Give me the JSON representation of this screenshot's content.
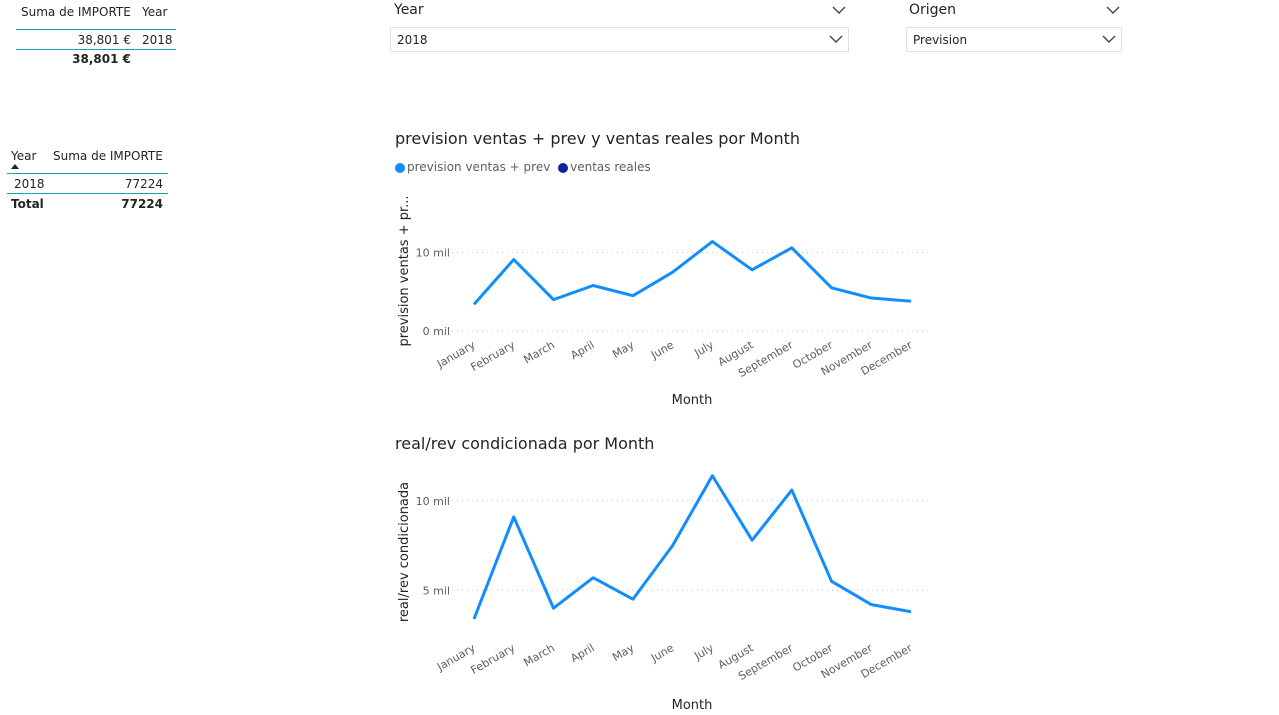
{
  "table_top": {
    "headers": [
      "Suma de IMPORTE",
      "Year"
    ],
    "row": {
      "importe": "38,801 €",
      "year": "2018"
    },
    "total": "38,801 €"
  },
  "table_left": {
    "headers": [
      "Year",
      "Suma de IMPORTE"
    ],
    "row": {
      "year": "2018",
      "importe": "77224"
    },
    "total_label": "Total",
    "total_value": "77224"
  },
  "slicer_year": {
    "title": "Year",
    "value": "2018"
  },
  "slicer_origen": {
    "title": "Origen",
    "value": "Prevision"
  },
  "chart1": {
    "title": "prevision ventas + prev y ventas reales por Month",
    "legend": [
      {
        "name": "prevision ventas + prev",
        "color": "#118DFF"
      },
      {
        "name": "ventas reales",
        "color": "#12239E"
      }
    ],
    "ylabel": "prevision ventas + pr...",
    "xlabel": "Month",
    "ytick_labels": [
      "0 mil",
      "10 mil"
    ]
  },
  "chart2": {
    "title": "real/rev condicionada por Month",
    "ylabel": "real/rev condicionada",
    "xlabel": "Month",
    "ytick_labels": [
      "5 mil",
      "10 mil"
    ]
  },
  "chart_data": [
    {
      "type": "line",
      "title": "prevision ventas + prev y ventas reales por Month",
      "xlabel": "Month",
      "ylabel": "prevision ventas + pr...",
      "categories": [
        "January",
        "February",
        "March",
        "April",
        "May",
        "June",
        "July",
        "August",
        "September",
        "October",
        "November",
        "December"
      ],
      "series": [
        {
          "name": "prevision ventas + prev",
          "color": "#118DFF",
          "values": [
            3400,
            9100,
            4000,
            5800,
            4500,
            7500,
            11400,
            7800,
            10600,
            5500,
            4200,
            3800
          ]
        }
      ],
      "yticks": [
        0,
        10000
      ],
      "ylim": [
        0,
        13000
      ],
      "grid": true,
      "legend_position": "top-left"
    },
    {
      "type": "line",
      "title": "real/rev condicionada por Month",
      "xlabel": "Month",
      "ylabel": "real/rev condicionada",
      "categories": [
        "January",
        "February",
        "March",
        "April",
        "May",
        "June",
        "July",
        "August",
        "September",
        "October",
        "November",
        "December"
      ],
      "series": [
        {
          "color": "#118DFF",
          "values": [
            3400,
            9100,
            4000,
            5700,
            4500,
            7500,
            11400,
            7800,
            10600,
            5500,
            4200,
            3800
          ]
        }
      ],
      "yticks": [
        5000,
        10000
      ],
      "ylim": [
        2500,
        12000
      ],
      "grid": true
    }
  ]
}
